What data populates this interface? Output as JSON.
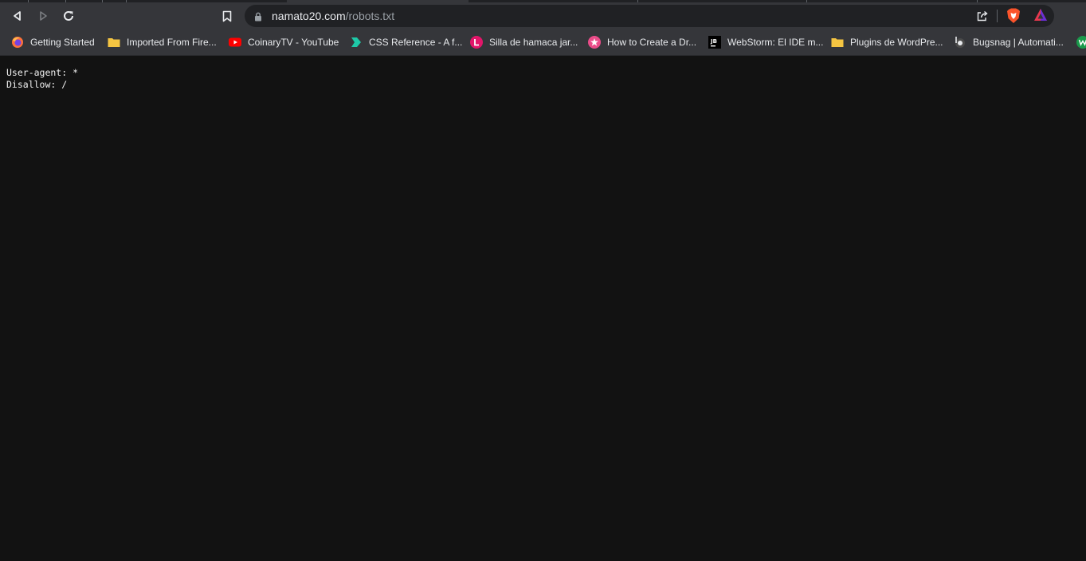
{
  "browser": {
    "address_bar": {
      "domain": "namato20.com",
      "path": "/robots.txt"
    },
    "bookmarks": [
      {
        "label": "Getting Started",
        "icon": "firefox-icon"
      },
      {
        "label": "Imported From Fire...",
        "icon": "folder-icon"
      },
      {
        "label": "CoinaryTV - YouTube",
        "icon": "youtube-icon"
      },
      {
        "label": "CSS Reference - A f...",
        "icon": "css-reference-icon"
      },
      {
        "label": "Silla de hamaca jar...",
        "icon": "l-badge-icon"
      },
      {
        "label": "How to Create a Dr...",
        "icon": "pink-star-icon"
      },
      {
        "label": "WebStorm: El IDE m...",
        "icon": "jetbrains-icon"
      },
      {
        "label": "Plugins de WordPre...",
        "icon": "folder-icon"
      },
      {
        "label": "Bugsnag | Automati...",
        "icon": "bugsnag-icon"
      }
    ]
  },
  "page": {
    "lines": [
      "User-agent: *",
      "Disallow: /"
    ]
  },
  "colors": {
    "toolbar": "#35363a",
    "omnibox": "#202124",
    "page_background": "#121212",
    "text": "#f1f1f1"
  }
}
